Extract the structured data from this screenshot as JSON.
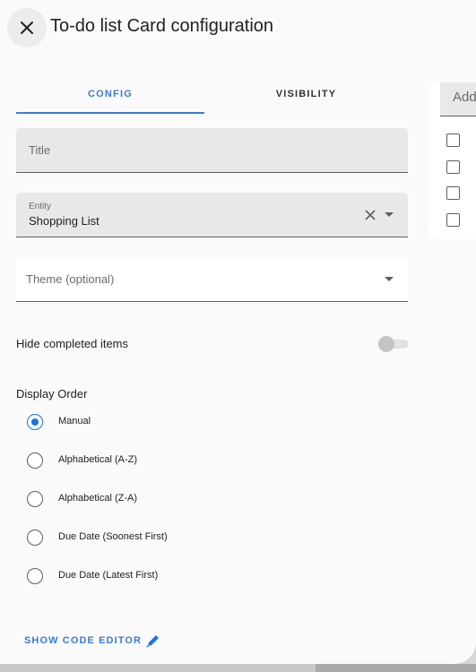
{
  "dialog": {
    "title": "To-do list Card configuration"
  },
  "tabs": [
    {
      "label": "CONFIG",
      "active": true
    },
    {
      "label": "VISIBILITY",
      "active": false
    }
  ],
  "form": {
    "title_field": {
      "placeholder": "Title",
      "value": ""
    },
    "entity_field": {
      "label": "Entity",
      "value": "Shopping List"
    },
    "theme_field": {
      "placeholder": "Theme (optional)",
      "value": ""
    },
    "hide_completed": {
      "label": "Hide completed items",
      "enabled": false
    },
    "display_order": {
      "label": "Display Order",
      "options": [
        {
          "label": "Manual",
          "checked": true
        },
        {
          "label": "Alphabetical (A-Z)",
          "checked": false
        },
        {
          "label": "Alphabetical (Z-A)",
          "checked": false
        },
        {
          "label": "Due Date (Soonest First)",
          "checked": false
        },
        {
          "label": "Due Date (Latest First)",
          "checked": false
        }
      ]
    }
  },
  "code_editor_label": "SHOW CODE EDITOR",
  "preview": {
    "add_placeholder": "Add",
    "checkbox_count": 4
  },
  "colors": {
    "accent": "#3a7bd5",
    "radio_checked": "#1a73e8",
    "field_fill": "#e8e8e8",
    "dialog_bg": "#fafafa"
  },
  "icons": {
    "close": "close-icon",
    "clear": "clear-icon",
    "dropdown": "chevron-down-icon",
    "edit": "pencil-icon"
  }
}
